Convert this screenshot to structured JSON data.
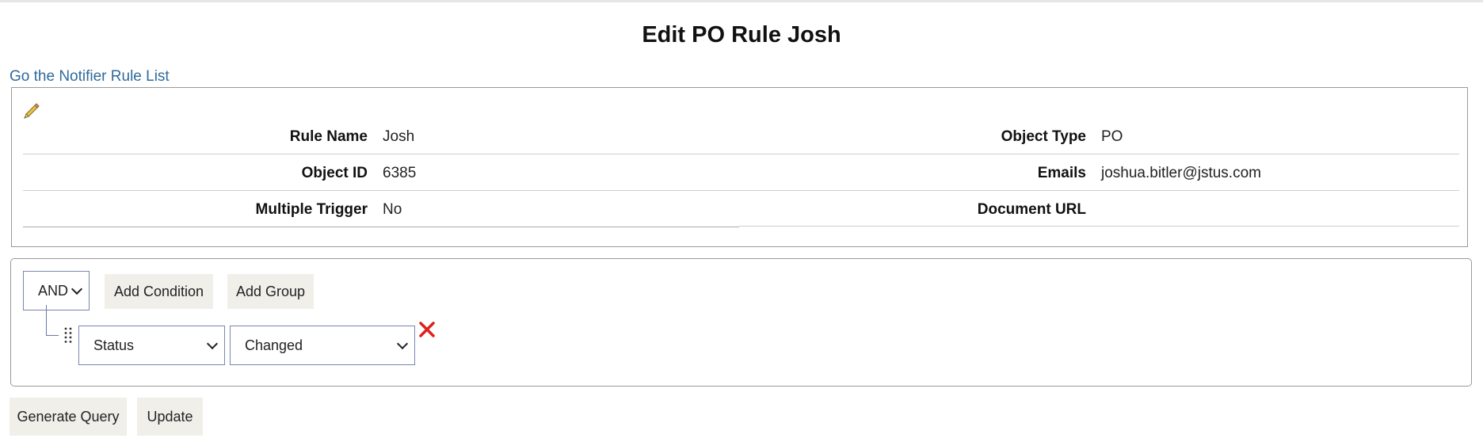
{
  "page": {
    "title": "Edit PO Rule Josh",
    "back_link": "Go the Notifier Rule List"
  },
  "details": {
    "edit_icon": "pencil-icon",
    "rows": [
      {
        "left_label": "Rule Name",
        "left_value": "Josh",
        "right_label": "Object Type",
        "right_value": "PO"
      },
      {
        "left_label": "Object ID",
        "left_value": "6385",
        "right_label": "Emails",
        "right_value": "joshua.bitler@jstus.com"
      },
      {
        "left_label": "Multiple Trigger",
        "left_value": "No",
        "right_label": "Document URL",
        "right_value": ""
      }
    ]
  },
  "query_builder": {
    "combinator": {
      "selected": "AND"
    },
    "add_condition_label": "Add Condition",
    "add_group_label": "Add Group",
    "rule": {
      "field": {
        "selected": "Status"
      },
      "operator": {
        "selected": "Changed"
      },
      "drag_icon": "drag-handle-icon",
      "remove_icon": "close-icon",
      "remove_color": "#e0201b"
    }
  },
  "actions": {
    "generate_query_label": "Generate Query",
    "update_label": "Update"
  }
}
